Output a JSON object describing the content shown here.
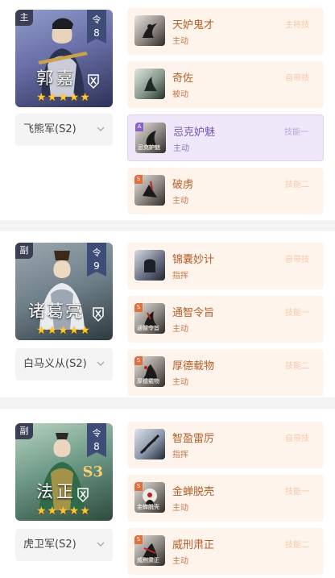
{
  "teams": [
    {
      "role": "主",
      "ling_label": "令",
      "ling_value": "8",
      "general_name": "郭嘉",
      "stars": "★★★★★",
      "troop": "飞熊军(S2)",
      "skills": [
        {
          "name": "天妒鬼才",
          "type": "主动",
          "slot": "主将技",
          "level": "",
          "icon_text": ""
        },
        {
          "name": "奇佐",
          "type": "被动",
          "slot": "自带技",
          "level": "",
          "icon_text": ""
        },
        {
          "name": "忌克妒魅",
          "type": "主动",
          "slot": "技能一",
          "level": "A",
          "icon_text": "忌克妒魅"
        },
        {
          "name": "破虏",
          "type": "主动",
          "slot": "技能二",
          "level": "S",
          "icon_text": ""
        }
      ]
    },
    {
      "role": "副",
      "ling_label": "令",
      "ling_value": "9",
      "general_name": "诸葛亮",
      "stars": "★★★★★",
      "troop": "白马义从(S2)",
      "skills": [
        {
          "name": "锦囊妙计",
          "type": "指挥",
          "slot": "自带技",
          "level": "",
          "icon_text": ""
        },
        {
          "name": "通智令旨",
          "type": "主动",
          "slot": "技能一",
          "level": "S",
          "icon_text": "通智令旨"
        },
        {
          "name": "厚德载物",
          "type": "主动",
          "slot": "技能二",
          "level": "S",
          "icon_text": "厚德载物"
        }
      ]
    },
    {
      "role": "副",
      "ling_label": "令",
      "ling_value": "8",
      "general_name": "法正",
      "s3_mark": "S3",
      "stars": "★★★★★",
      "troop": "虎卫军(S2)",
      "skills": [
        {
          "name": "智盈雷厉",
          "type": "指挥",
          "slot": "自带技",
          "level": "",
          "icon_text": ""
        },
        {
          "name": "金蝉脱壳",
          "type": "主动",
          "slot": "技能一",
          "level": "S",
          "icon_text": "金蝉脱壳"
        },
        {
          "name": "威刑肃正",
          "type": "主动",
          "slot": "技能二",
          "level": "S",
          "icon_text": "威刑肃正"
        }
      ]
    }
  ],
  "icons": {
    "chevron": "chevron-down-icon",
    "faction": "faction-emblem-icon"
  },
  "colors": {
    "skill_bg": "#fff4ec",
    "skill_highlight_bg": "#efe8fb",
    "skill_name": "#b45d27",
    "star": "#ffc83a"
  }
}
